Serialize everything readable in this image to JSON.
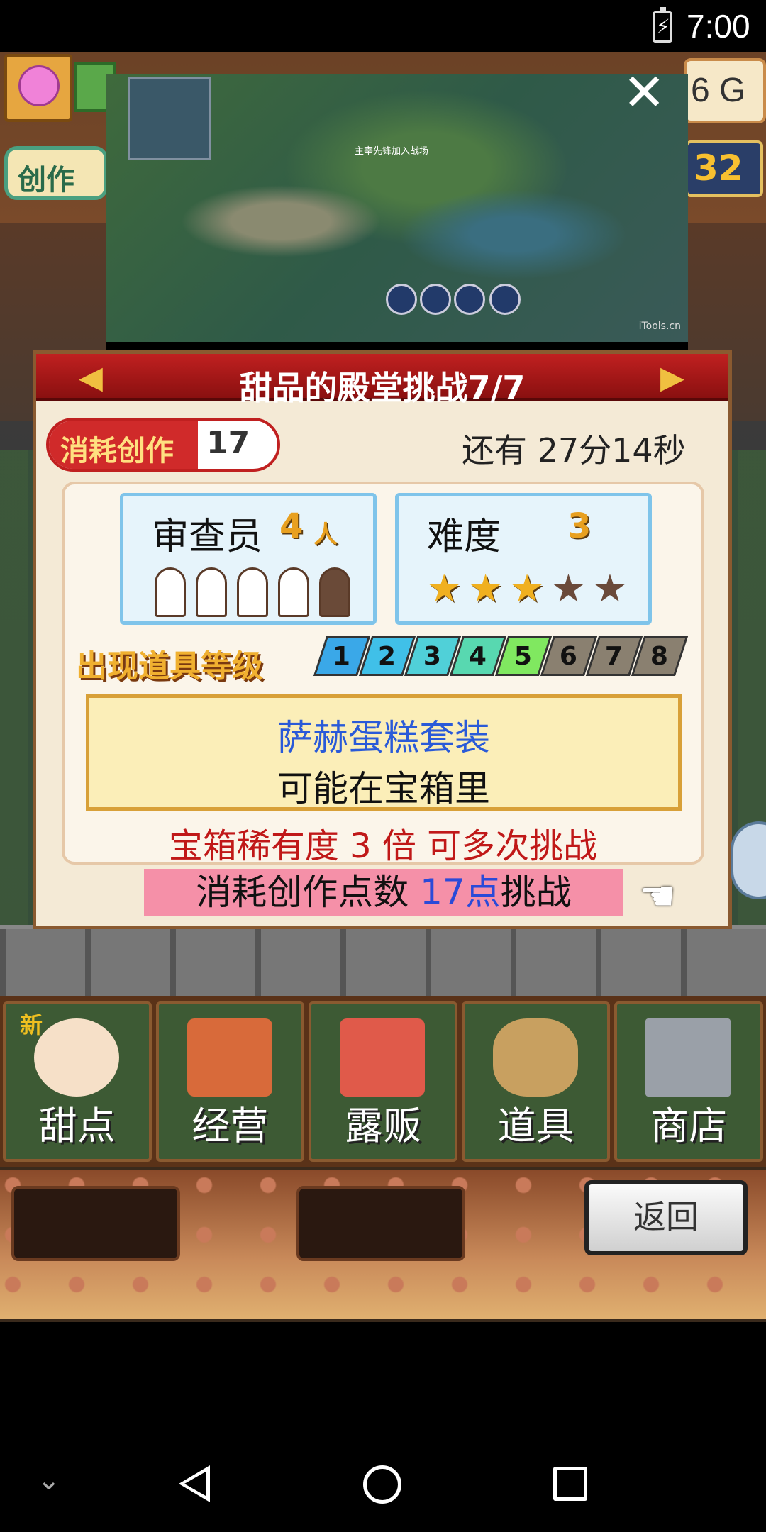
{
  "status_bar": {
    "time": "7:00",
    "battery_icon": "battery-charging-icon"
  },
  "hud": {
    "money": "6 G",
    "create_label": "创作",
    "create_count": "32"
  },
  "video": {
    "caption": "主宰先锋加入战场",
    "watermark": "iTools.cn",
    "close_icon": "close-icon"
  },
  "challenge": {
    "title": "甜品的殿堂挑战7/7",
    "cost_label": "消耗创作",
    "cost_value": "17",
    "timer": "还有 27分14秒",
    "reviewers": {
      "label": "审查员",
      "count": "4",
      "suffix": "人",
      "total": 5,
      "filled": 4
    },
    "difficulty": {
      "label": "难度",
      "level": "3",
      "stars_total": 5,
      "stars_on": 3
    },
    "item_level_label": "出现道具等级",
    "levels": [
      "1",
      "2",
      "3",
      "4",
      "5",
      "6",
      "7",
      "8"
    ],
    "levels_active": 5,
    "reward": {
      "name": "萨赫蛋糕套装",
      "note": "可能在宝箱里"
    },
    "rarity": "宝箱稀有度 3 倍 可多次挑战",
    "cta": {
      "prefix": "消耗创作点数 ",
      "points": "17点",
      "suffix": "挑战"
    }
  },
  "menu": {
    "items": [
      {
        "label": "甜点",
        "icon": "cake-icon",
        "badge": "新"
      },
      {
        "label": "经营",
        "icon": "shop-icon"
      },
      {
        "label": "露贩",
        "icon": "food-truck-icon"
      },
      {
        "label": "道具",
        "icon": "item-bag-icon"
      },
      {
        "label": "商店",
        "icon": "cart-icon"
      }
    ],
    "back_label": "返回"
  },
  "colors": {
    "panel_red": "#c02020",
    "reward_blue": "#2a5ad8",
    "rarity_red": "#c01818",
    "cta_pink": "#f590a8"
  }
}
